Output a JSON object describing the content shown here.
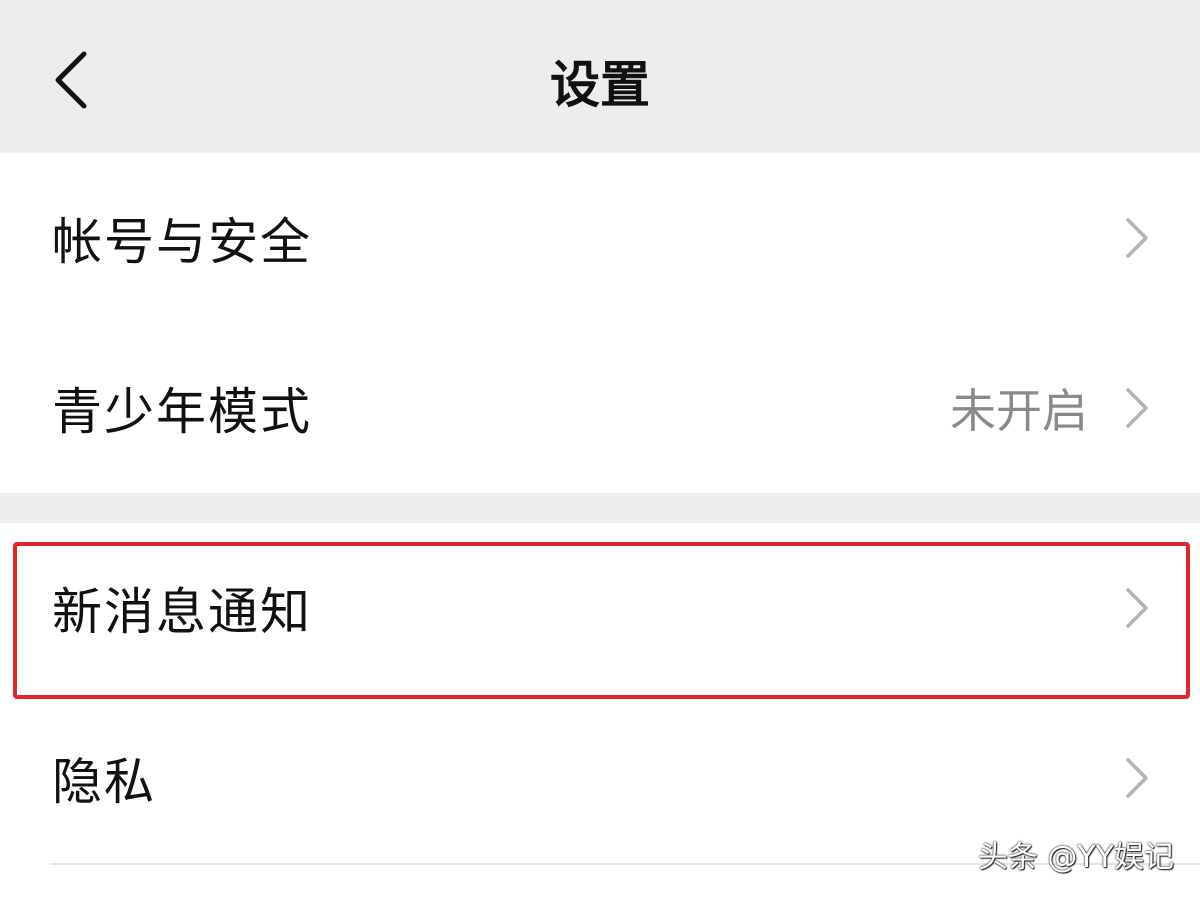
{
  "nav": {
    "title": "设置",
    "back_icon": "chevron-left-icon"
  },
  "groups": [
    {
      "items": [
        {
          "label": "帐号与安全",
          "value": "",
          "chevron_icon": "chevron-right-icon"
        },
        {
          "label": "青少年模式",
          "value": "未开启",
          "chevron_icon": "chevron-right-icon"
        }
      ]
    },
    {
      "items": [
        {
          "label": "新消息通知",
          "value": "",
          "chevron_icon": "chevron-right-icon",
          "highlighted": true
        },
        {
          "label": "隐私",
          "value": "",
          "chevron_icon": "chevron-right-icon"
        }
      ]
    }
  ],
  "annotation": {
    "highlight_color": "#e0262b"
  },
  "watermark": {
    "text": "头条 @YY娱记"
  },
  "colors": {
    "nav_background": "#ededed",
    "row_background": "#ffffff",
    "secondary_text": "#8a8a8a"
  }
}
